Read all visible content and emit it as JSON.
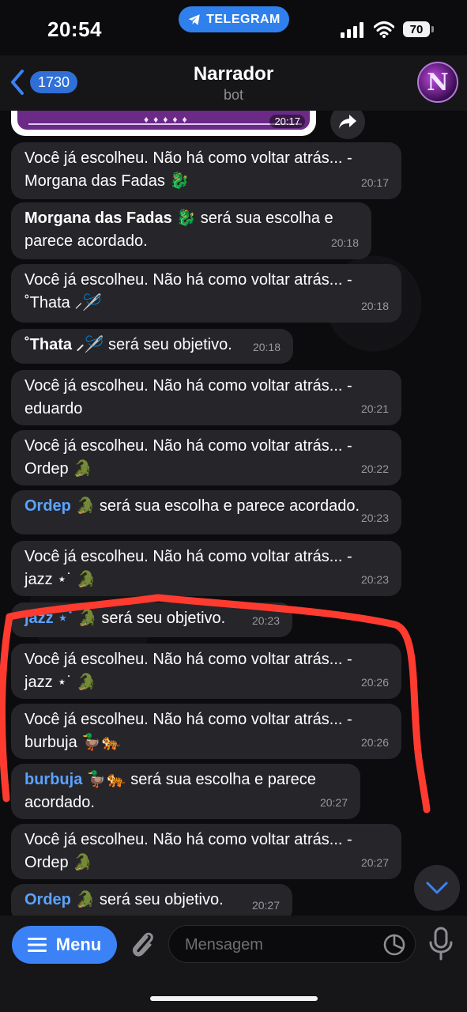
{
  "status_bar": {
    "time": "20:54",
    "app_pill": "TELEGRAM",
    "battery": "70"
  },
  "header": {
    "back_badge": "1730",
    "title": "Narrador",
    "subtitle": "bot",
    "avatar_letter": "N"
  },
  "top_image": {
    "time": "20:17"
  },
  "messages": [
    {
      "line1": "Você já escolheu. Não há como voltar atrás... -",
      "line2": "Morgana das Fadas 🐉",
      "time": "20:17"
    },
    {
      "bold": "Morgana das Fadas 🐉",
      "line1_rest": " será sua escolha e",
      "line2": "parece acordado.",
      "time": "20:18"
    },
    {
      "line1": "Você já escolheu. Não há como voltar atrás... -",
      "line2": "˚Thata ⸝🪡",
      "time": "20:18"
    },
    {
      "bold": "˚Thata ⸝🪡",
      "line1_rest": " será seu objetivo.",
      "time": "20:18"
    },
    {
      "line1": "Você já escolheu. Não há como voltar atrás... -",
      "line2": "eduardo",
      "time": "20:21"
    },
    {
      "line1": "Você já escolheu. Não há como voltar atrás... -",
      "line2": "Ordep 🐊",
      "time": "20:22"
    },
    {
      "name": "Ordep 🐊",
      "line1_rest": " será sua escolha e parece acordado.",
      "time": "20:23"
    },
    {
      "line1": "Você já escolheu. Não há como voltar atrás... -",
      "line2": "jazz ⋆˙ 🐊",
      "time": "20:23"
    },
    {
      "name": "jazz ⋆˙ 🐊",
      "line1_rest": " será seu objetivo.",
      "time": "20:23"
    },
    {
      "line1": "Você já escolheu. Não há como voltar atrás... -",
      "line2": "jazz ⋆˙ 🐊",
      "time": "20:26"
    },
    {
      "line1": "Você já escolheu. Não há como voltar atrás... -",
      "line2": "burbuja 🦆🐅",
      "time": "20:26"
    },
    {
      "name": "burbuja 🦆🐅",
      "line1_rest": " será sua escolha e parece",
      "line2": "acordado.",
      "time": "20:27"
    },
    {
      "line1": "Você já escolheu. Não há como voltar atrás... -",
      "line2": "Ordep 🐊",
      "time": "20:27"
    },
    {
      "name": "Ordep 🐊",
      "line1_rest": " será seu objetivo.",
      "time": "20:27"
    }
  ],
  "bottom": {
    "menu_label": "Menu",
    "input_placeholder": "Mensagem"
  },
  "colors": {
    "accent": "#3b82f6",
    "bubble": "#26252a",
    "name": "#5aa3ff",
    "annotation": "#ff3b30"
  }
}
